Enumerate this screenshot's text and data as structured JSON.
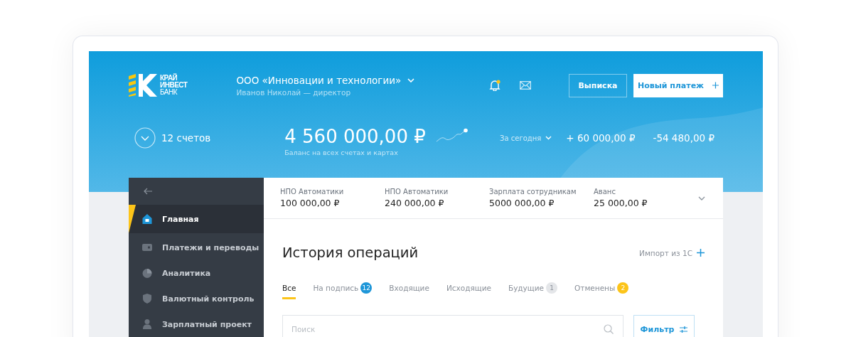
{
  "logo": {
    "lines": [
      "КРАЙ",
      "ИНВЕСТ",
      "БАНК"
    ]
  },
  "company": {
    "name": "ООО «Инновации и технологии»",
    "person": "Иванов Николай — директор"
  },
  "notifications": {
    "unread": true
  },
  "buttons": [
    {
      "label": "Выписка",
      "kind": "outline"
    },
    {
      "label": "Новый платеж",
      "kind": "primary"
    }
  ],
  "accounts": {
    "count": "12 счетов",
    "balance": "4 560 000,00 ₽",
    "balance_caption": "Баланс на всех счетах и картах"
  },
  "period": {
    "label": "За сегодня",
    "income": "+ 60 000,00 ₽",
    "expense": "-54 480,00 ₽"
  },
  "sidebar": {
    "items": [
      {
        "label": "Главная",
        "selected": true
      },
      {
        "label": "Платежи и переводы",
        "selected": false
      },
      {
        "label": "Аналитика",
        "selected": false
      },
      {
        "label": "Валютный контроль",
        "selected": false
      },
      {
        "label": "Зарплатный проект",
        "selected": false
      }
    ]
  },
  "account_strip": [
    {
      "name": "НПО Автоматики",
      "amount": "100 000,00 ₽"
    },
    {
      "name": "НПО Автоматики",
      "amount": "240 000,00 ₽"
    },
    {
      "name": "Зарплата сотрудникам",
      "amount": "5000 000,00 ₽"
    },
    {
      "name": "Аванс",
      "amount": "25 000,00 ₽"
    }
  ],
  "history": {
    "title": "История операций",
    "import_label": "Импорт из 1С",
    "tabs": [
      {
        "label": "Все",
        "selected": true
      },
      {
        "label": "На подпись",
        "selected": false,
        "badge": "12",
        "color": "#1e96d8"
      },
      {
        "label": "Входящие",
        "selected": false
      },
      {
        "label": "Исходящие",
        "selected": false
      },
      {
        "label": "Будущие",
        "selected": false,
        "badge": "1",
        "color": "#e4e6e9"
      },
      {
        "label": "Отменены",
        "selected": false,
        "badge": "2",
        "color": "#fcc419"
      }
    ],
    "search": {
      "placeholder": "Поиск"
    },
    "filter_label": "Фильтр"
  }
}
